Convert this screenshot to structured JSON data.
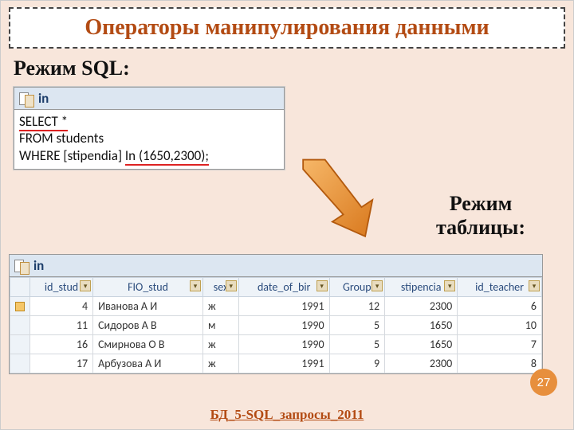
{
  "title": "Операторы манипулирования данными",
  "sql_section": {
    "label": "Режим SQL:",
    "tab_name": "in",
    "query_lines": [
      "SELECT *",
      "FROM students",
      "WHERE [stipendia] In (1650,2300);"
    ]
  },
  "table_section": {
    "label_line1": "Режим",
    "label_line2": "таблицы:",
    "tab_name": "in",
    "columns": [
      "id_stud",
      "FIO_stud",
      "sex",
      "date_of_bir",
      "Group",
      "stipencia",
      "id_teacher"
    ],
    "rows": [
      {
        "id_stud": 4,
        "FIO_stud": "Иванова А И",
        "sex": "ж",
        "date_of_bir": 1991,
        "Group": 12,
        "stipencia": 2300,
        "id_teacher": 6
      },
      {
        "id_stud": 11,
        "FIO_stud": "Сидоров А В",
        "sex": "м",
        "date_of_bir": 1990,
        "Group": 5,
        "stipencia": 1650,
        "id_teacher": 10
      },
      {
        "id_stud": 16,
        "FIO_stud": "Смирнова О В",
        "sex": "ж",
        "date_of_bir": 1990,
        "Group": 5,
        "stipencia": 1650,
        "id_teacher": 7
      },
      {
        "id_stud": 17,
        "FIO_stud": "Арбузова А И",
        "sex": "ж",
        "date_of_bir": 1991,
        "Group": 9,
        "stipencia": 2300,
        "id_teacher": 8
      }
    ]
  },
  "slide_number": "27",
  "footer": "БД_5-SQL_запросы_2011"
}
